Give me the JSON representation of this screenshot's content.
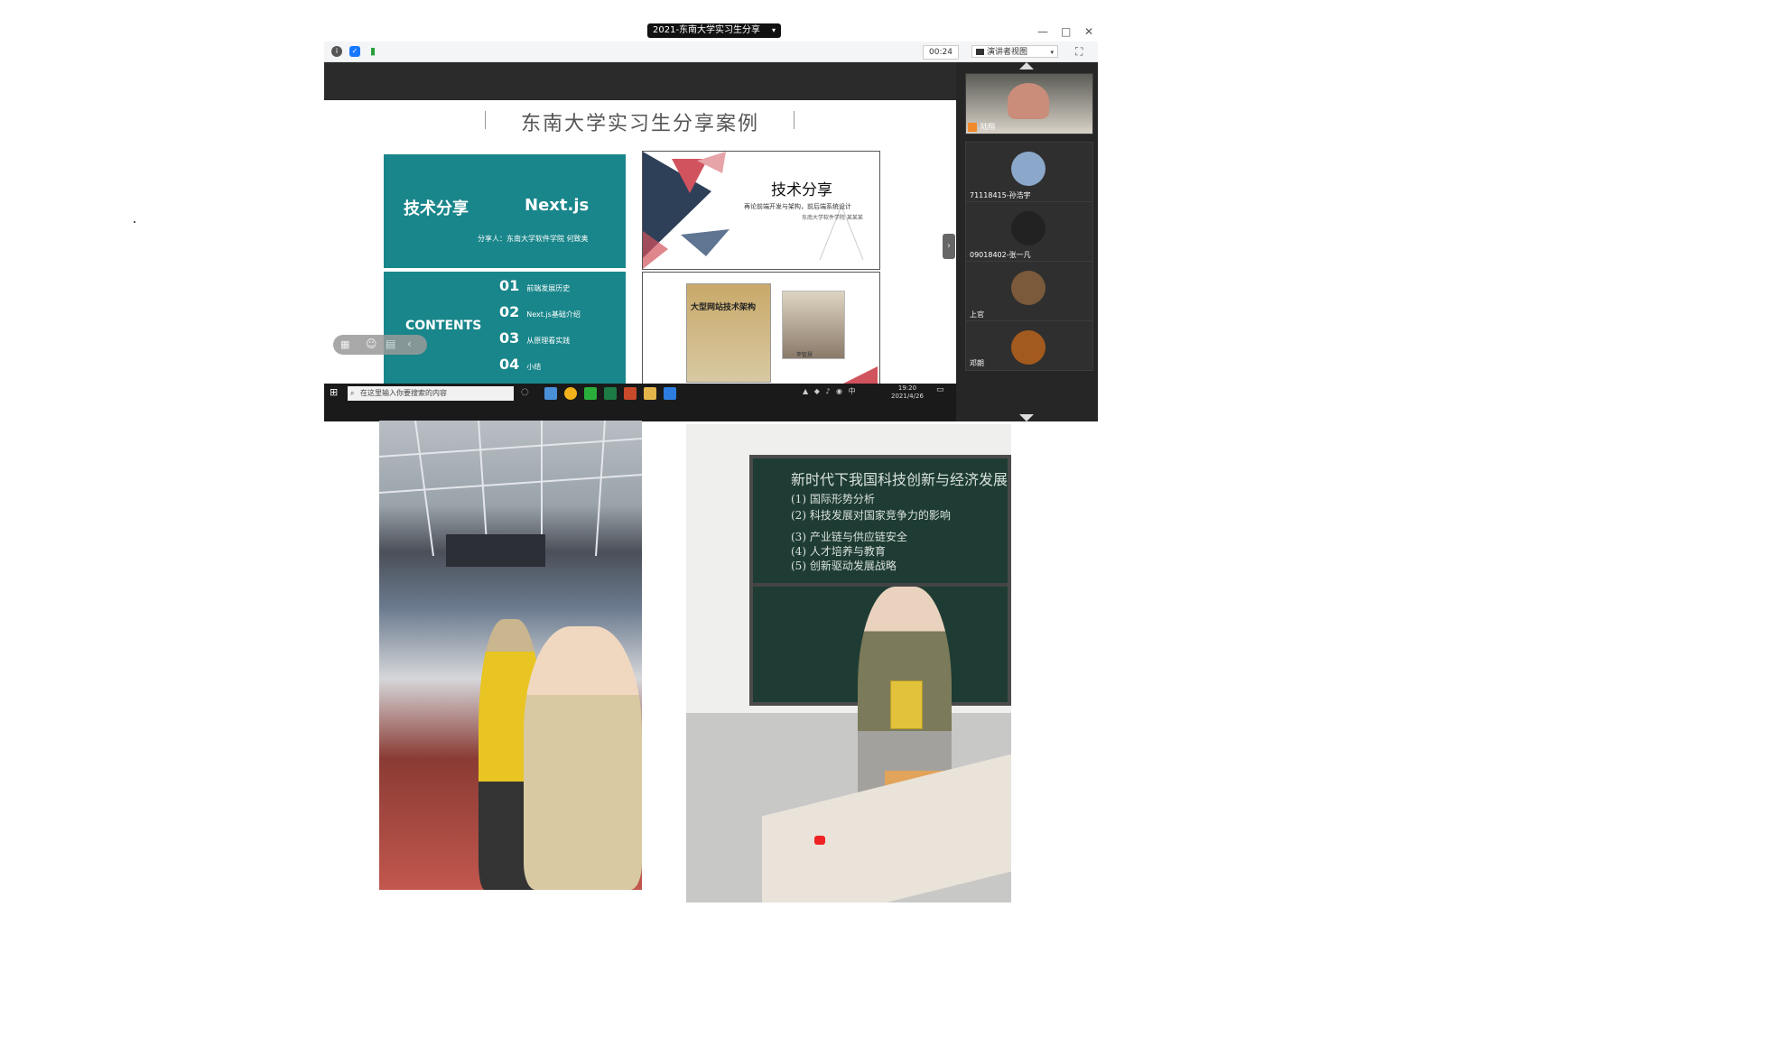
{
  "window": {
    "title": "2021-东南大学实习生分享",
    "minimize": "—",
    "maximize": "□",
    "close": "✕"
  },
  "toolbar": {
    "timer": "00:24",
    "view_label": "演讲者视图"
  },
  "slide": {
    "title": "东南大学实习生分享案例",
    "panel_a": {
      "title": "技术分享",
      "product": "Next.js",
      "presenter": "分享人：东南大学软件学院 何致奥"
    },
    "panel_b": {
      "label": "CONTENTS",
      "items": [
        {
          "num": "01",
          "text": "前端发展历史"
        },
        {
          "num": "02",
          "text": "Next.js基础介绍"
        },
        {
          "num": "03",
          "text": "从原理看实践"
        },
        {
          "num": "04",
          "text": "小结"
        }
      ]
    },
    "panel_c": {
      "title": "技术分享",
      "subtitle": "再论前端开发与架构，前后端系统设计",
      "author": "东南大学软件学院 某某某"
    },
    "panel_d": {
      "book_title": "大型网站技术架构",
      "person_name": "· 李智慧"
    }
  },
  "taskbar": {
    "search_placeholder": "在这里输入你要搜索的内容",
    "time": "19:20",
    "date": "2021/4/26"
  },
  "participants": [
    {
      "name": "陆翔",
      "avatar_color": "#c98d7a"
    },
    {
      "name": "71118415-孙浩宇",
      "avatar_color": "#8ba7c9"
    },
    {
      "name": "09018402-张一凡",
      "avatar_color": "#222222"
    },
    {
      "name": "上官",
      "avatar_color": "#7a5a3a"
    },
    {
      "name": "邓朗",
      "avatar_color": "#a35a1e"
    }
  ],
  "photos": {
    "blackboard_lines": [
      "新时代下我国科技创新与经济发展",
      "(1) 国际形势分析",
      "(2) 科技发展对国家竞争力的影响",
      "(3) 产业链与供应链安全",
      "(4) 人才培养与教育",
      "(5) 创新驱动发展战略"
    ]
  }
}
